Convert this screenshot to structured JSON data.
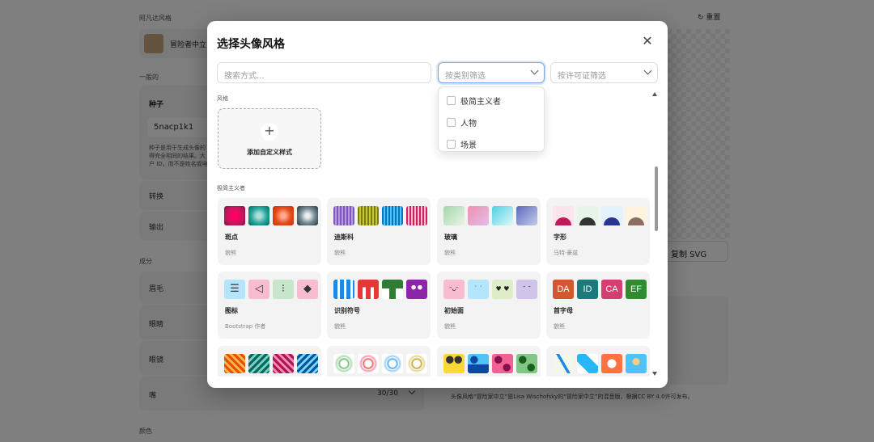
{
  "background": {
    "section_avatar_style": "阿凡达风格",
    "current_style_name": "冒险者中立",
    "section_general": "一般的",
    "seed_label": "种子",
    "seed_value": "5nacp1k1",
    "seed_desc_1": "种子是用于生成头像的",
    "seed_desc_2": "得完全相同的结果。大",
    "seed_desc_3": "户 ID，而不是姓名或电",
    "transform_label": "转换",
    "output_label": "输出",
    "section_components": "成分",
    "eyebrows_label": "眉毛",
    "eyes_label": "眼睛",
    "glasses_label": "眼镜",
    "mouth_label": "嘴",
    "mouth_count": "30/30",
    "section_colors": "颜色",
    "reset_label": "重置",
    "copy_svg_label": "复制 SVG",
    "license_text": "头像风格“冒险家中立”是Lisa Wischofsky的“冒险家中立”的混音版，根据CC BY 4.0许可发布。"
  },
  "modal": {
    "title": "选择头像风格",
    "search_placeholder": "搜索方式...",
    "category_filter_placeholder": "按类别筛选",
    "license_filter_placeholder": "按许可证筛选",
    "category_options": [
      "极简主义者",
      "人物",
      "场景"
    ],
    "section_styles": "风格",
    "add_custom_label": "添加自定义样式",
    "section_minimalist": "极简主义者",
    "tiles": [
      {
        "name": "斑点",
        "author": "貌熊"
      },
      {
        "name": "迪斯科",
        "author": "貌熊"
      },
      {
        "name": "玻璃",
        "author": "貌熊"
      },
      {
        "name": "字形",
        "author": "马特·豪兹"
      },
      {
        "name": "图标",
        "author": "Bootstrap 作者"
      },
      {
        "name": "识别符号",
        "author": "貌熊"
      },
      {
        "name": "初始面",
        "author": "貌熊"
      },
      {
        "name": "首字母",
        "author": "貌熊"
      }
    ],
    "initials_letters": [
      "DA",
      "ID",
      "CA",
      "EF"
    ]
  },
  "colors": {
    "overlay": "#000000",
    "accent_focus": "#7aa6e6"
  }
}
